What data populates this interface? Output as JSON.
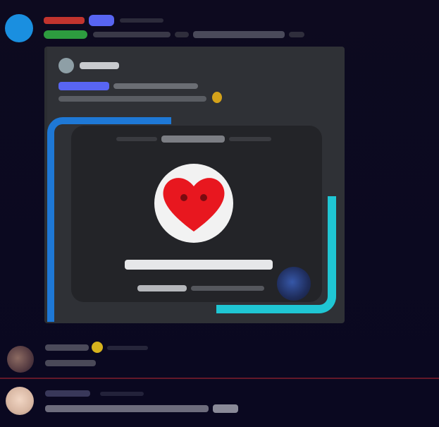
{
  "colors": {
    "background": "#0c0a1f",
    "bot_avatar": "#1a8fe0",
    "username_red": "#c2342e",
    "bot_tag": "#5865f2",
    "role_green": "#2d9c3f",
    "embed_bg": "#2f3136",
    "card_bg": "#232428",
    "frame_blue": "#1e78d6",
    "frame_cyan": "#1fc6d4",
    "heart": "#e8171f",
    "separator": "#8a1f2e"
  },
  "icons": {
    "bot_avatar": "circle-avatar-icon",
    "embed_author": "author-avatar-icon",
    "heart": "heart-icon",
    "emoji": "emoji-icon",
    "member_avatar": "avatar-icon"
  },
  "main_message": {
    "username": "",
    "bot_tag": "",
    "timestamp": "",
    "role_badge": "",
    "content": "",
    "embed": {
      "author": "",
      "description": "",
      "card": {
        "header": "",
        "title": "",
        "subtitle": ""
      }
    }
  },
  "message_2": {
    "username": "",
    "timestamp": "",
    "content": ""
  },
  "message_3": {
    "username": "",
    "timestamp": "",
    "content": ""
  }
}
